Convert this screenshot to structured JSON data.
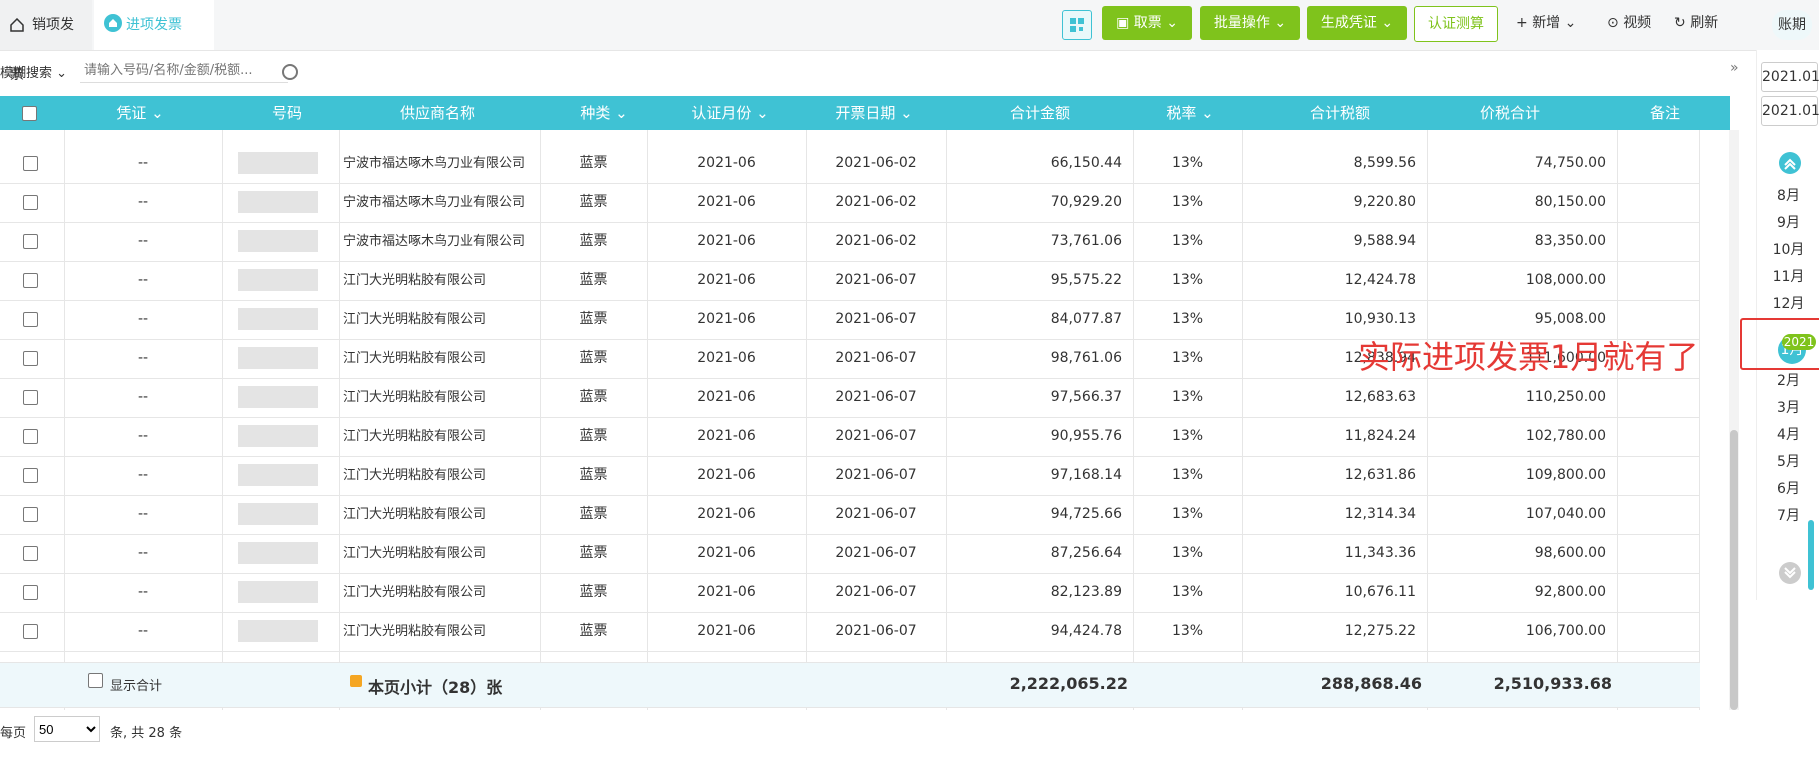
{
  "tabs": [
    {
      "label": "销项发票"
    },
    {
      "label": "进项发票"
    }
  ],
  "toolbar": {
    "take_ticket": "取票",
    "batch_ops": "批量操作",
    "gen_voucher": "生成凭证",
    "cert_calc": "认证测算",
    "add_new": "新增",
    "video": "视频",
    "refresh": "刷新",
    "account_period": "账期"
  },
  "search": {
    "mode": "模糊搜索",
    "placeholder": "请输入号码/名称/金额/税额..."
  },
  "table": {
    "headers": [
      "凭证",
      "号码",
      "供应商名称",
      "种类",
      "认证月份",
      "开票日期",
      "合计金额",
      "税率",
      "合计税额",
      "价税合计",
      "备注"
    ],
    "rows": [
      {
        "voucher": "--",
        "number": "",
        "supplier": "宁波市福达啄木鸟刀业有限公司",
        "kind": "蓝票",
        "cert_month": "2021-06",
        "invoice_date": "2021-06-02",
        "amount": "66,150.44",
        "tax_rate": "13%",
        "tax": "8,599.56",
        "total": "74,750.00",
        "note": ""
      },
      {
        "voucher": "--",
        "number": "",
        "supplier": "宁波市福达啄木鸟刀业有限公司",
        "kind": "蓝票",
        "cert_month": "2021-06",
        "invoice_date": "2021-06-02",
        "amount": "70,929.20",
        "tax_rate": "13%",
        "tax": "9,220.80",
        "total": "80,150.00",
        "note": ""
      },
      {
        "voucher": "--",
        "number": "",
        "supplier": "宁波市福达啄木鸟刀业有限公司",
        "kind": "蓝票",
        "cert_month": "2021-06",
        "invoice_date": "2021-06-02",
        "amount": "73,761.06",
        "tax_rate": "13%",
        "tax": "9,588.94",
        "total": "83,350.00",
        "note": ""
      },
      {
        "voucher": "--",
        "number": "",
        "supplier": "江门大光明粘胶有限公司",
        "kind": "蓝票",
        "cert_month": "2021-06",
        "invoice_date": "2021-06-07",
        "amount": "95,575.22",
        "tax_rate": "13%",
        "tax": "12,424.78",
        "total": "108,000.00",
        "note": ""
      },
      {
        "voucher": "--",
        "number": "",
        "supplier": "江门大光明粘胶有限公司",
        "kind": "蓝票",
        "cert_month": "2021-06",
        "invoice_date": "2021-06-07",
        "amount": "84,077.87",
        "tax_rate": "13%",
        "tax": "10,930.13",
        "total": "95,008.00",
        "note": ""
      },
      {
        "voucher": "--",
        "number": "",
        "supplier": "江门大光明粘胶有限公司",
        "kind": "蓝票",
        "cert_month": "2021-06",
        "invoice_date": "2021-06-07",
        "amount": "98,761.06",
        "tax_rate": "13%",
        "tax": "12,838.94",
        "total": "111,600.00",
        "note": ""
      },
      {
        "voucher": "--",
        "number": "",
        "supplier": "江门大光明粘胶有限公司",
        "kind": "蓝票",
        "cert_month": "2021-06",
        "invoice_date": "2021-06-07",
        "amount": "97,566.37",
        "tax_rate": "13%",
        "tax": "12,683.63",
        "total": "110,250.00",
        "note": ""
      },
      {
        "voucher": "--",
        "number": "",
        "supplier": "江门大光明粘胶有限公司",
        "kind": "蓝票",
        "cert_month": "2021-06",
        "invoice_date": "2021-06-07",
        "amount": "90,955.76",
        "tax_rate": "13%",
        "tax": "11,824.24",
        "total": "102,780.00",
        "note": ""
      },
      {
        "voucher": "--",
        "number": "",
        "supplier": "江门大光明粘胶有限公司",
        "kind": "蓝票",
        "cert_month": "2021-06",
        "invoice_date": "2021-06-07",
        "amount": "97,168.14",
        "tax_rate": "13%",
        "tax": "12,631.86",
        "total": "109,800.00",
        "note": ""
      },
      {
        "voucher": "--",
        "number": "",
        "supplier": "江门大光明粘胶有限公司",
        "kind": "蓝票",
        "cert_month": "2021-06",
        "invoice_date": "2021-06-07",
        "amount": "94,725.66",
        "tax_rate": "13%",
        "tax": "12,314.34",
        "total": "107,040.00",
        "note": ""
      },
      {
        "voucher": "--",
        "number": "",
        "supplier": "江门大光明粘胶有限公司",
        "kind": "蓝票",
        "cert_month": "2021-06",
        "invoice_date": "2021-06-07",
        "amount": "87,256.64",
        "tax_rate": "13%",
        "tax": "11,343.36",
        "total": "98,600.00",
        "note": ""
      },
      {
        "voucher": "--",
        "number": "",
        "supplier": "江门大光明粘胶有限公司",
        "kind": "蓝票",
        "cert_month": "2021-06",
        "invoice_date": "2021-06-07",
        "amount": "82,123.89",
        "tax_rate": "13%",
        "tax": "10,676.11",
        "total": "92,800.00",
        "note": ""
      },
      {
        "voucher": "--",
        "number": "",
        "supplier": "江门大光明粘胶有限公司",
        "kind": "蓝票",
        "cert_month": "2021-06",
        "invoice_date": "2021-06-07",
        "amount": "94,424.78",
        "tax_rate": "13%",
        "tax": "12,275.22",
        "total": "106,700.00",
        "note": ""
      }
    ]
  },
  "summary": {
    "show_total": "显示合计",
    "page_subtotal": "本页小计（28）张",
    "amount": "2,222,065.22",
    "tax": "288,868.46",
    "total": "2,510,933.68"
  },
  "pager": {
    "per_page": "每页",
    "page_size": "50",
    "count_text": "条, 共 28 条"
  },
  "side": {
    "date_from": "2021.01",
    "date_to": "2021.01",
    "months_above": [
      "8月",
      "9月",
      "10月",
      "11月",
      "12月"
    ],
    "selected_year": "2021",
    "selected_month": "1月",
    "months_below": [
      "2月",
      "3月",
      "4月",
      "5月",
      "6月",
      "7月"
    ]
  },
  "annotation": "实际进项发票1月就有了",
  "colors": {
    "accent": "#3fc2d4",
    "green": "#7fc31c",
    "annotation": "#e53935"
  }
}
